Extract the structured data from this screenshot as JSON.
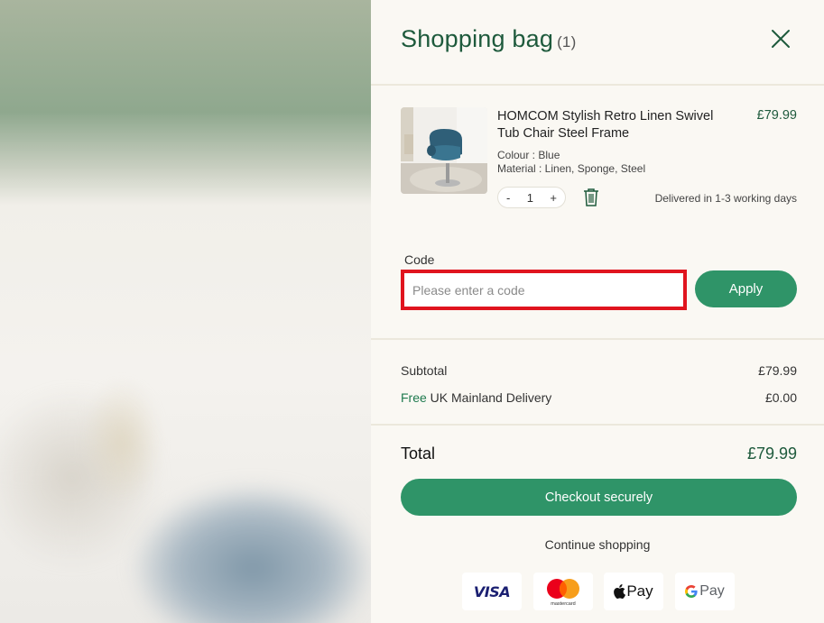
{
  "bag": {
    "title": "Shopping bag",
    "count": "(1)"
  },
  "item": {
    "name": "HOMCOM Stylish Retro Linen Swivel Tub Chair Steel Frame",
    "price": "£79.99",
    "colour": "Colour : Blue",
    "material": "Material : Linen, Sponge, Steel",
    "quantity": "1",
    "minus": "-",
    "plus": "+",
    "delivery": "Delivered in 1-3 working days"
  },
  "code": {
    "label": "Code",
    "placeholder": "Please enter a code",
    "apply_label": "Apply"
  },
  "summary": {
    "subtotal_label": "Subtotal",
    "subtotal_value": "£79.99",
    "delivery_free": "Free",
    "delivery_label": " UK Mainland Delivery",
    "delivery_value": "£0.00",
    "total_label": "Total",
    "total_value": "£79.99"
  },
  "actions": {
    "checkout_label": "Checkout securely",
    "continue_label": "Continue shopping"
  },
  "payments": {
    "visa": "VISA",
    "mastercard": "mastercard",
    "apple_pay": "Pay",
    "google_pay": "Pay"
  },
  "colors": {
    "brand_green": "#2f9468",
    "title_green": "#1e5a3c",
    "highlight_red": "#e0141e",
    "drawer_bg": "#faf8f3"
  },
  "icons": [
    "close-icon",
    "trash-icon",
    "apple-icon",
    "google-g-icon",
    "mastercard-icon"
  ]
}
